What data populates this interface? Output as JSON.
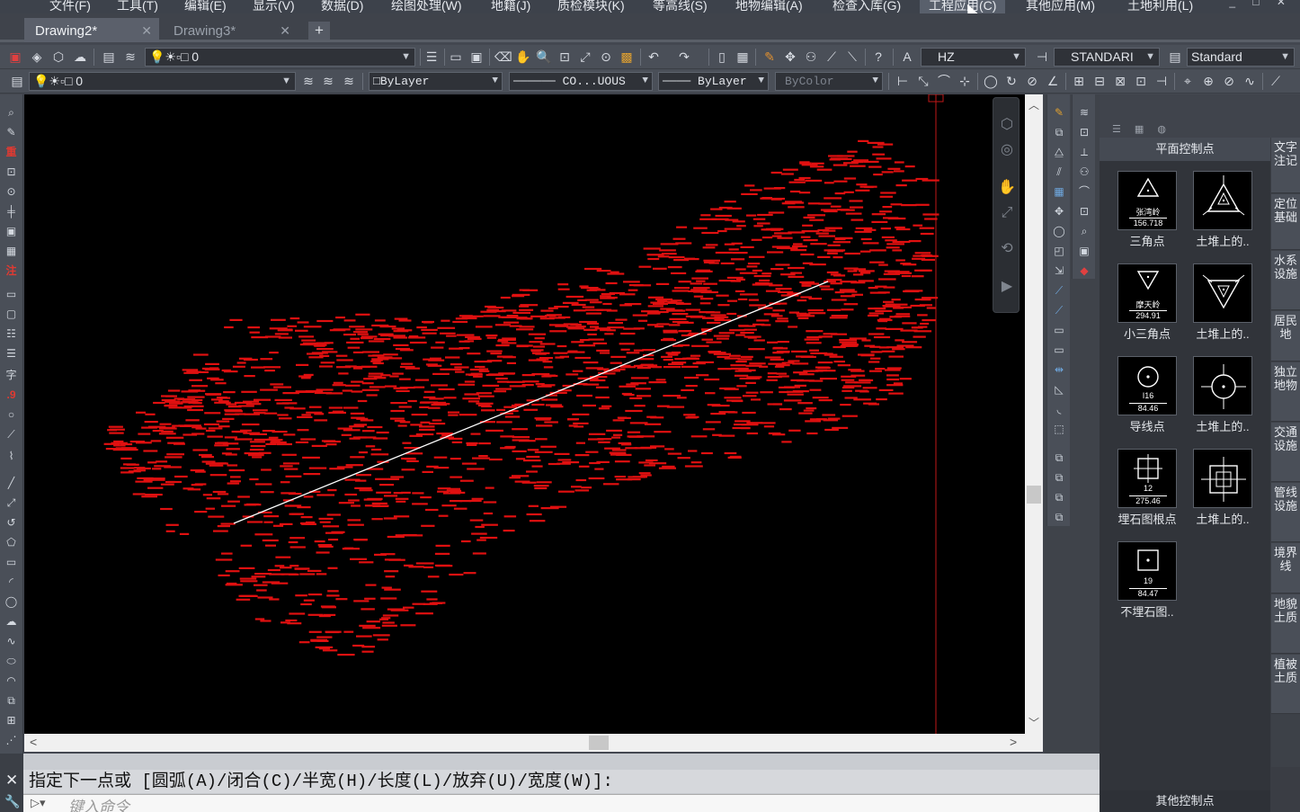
{
  "menu": [
    {
      "label": "文件(F)"
    },
    {
      "label": "工具(T)"
    },
    {
      "label": "编辑(E)"
    },
    {
      "label": "显示(V)"
    },
    {
      "label": "数据(D)"
    },
    {
      "label": "绘图处理(W)"
    },
    {
      "label": "地籍(J)"
    },
    {
      "label": "质检模块(K)"
    },
    {
      "label": "等高线(S)"
    },
    {
      "label": "地物编辑(A)"
    },
    {
      "label": "检查入库(G)"
    },
    {
      "label": "工程应用(C)"
    },
    {
      "label": "其他应用(M)"
    },
    {
      "label": "土地利用(L)"
    }
  ],
  "tabs": [
    {
      "label": "Drawing2*",
      "close": "✕"
    },
    {
      "label": "Drawing3*",
      "close": "✕"
    }
  ],
  "tab_add": "+",
  "toolbar1": {
    "layer_value": "0",
    "textstyle_value": "HZ",
    "dimstyle_value": "STANDARI",
    "tablestyle_value": "Standard"
  },
  "toolbar2": {
    "layer_value": "0",
    "color_value": "ByLayer",
    "linetype_value": "CO...UOUS",
    "lineweight_value": "ByLayer",
    "plotstyle_value": "ByColor"
  },
  "palette": {
    "title": "平面控制点",
    "footer": "其他控制点",
    "symbols": [
      {
        "label": "三角点",
        "name": "张湾岭",
        "value": "156.718",
        "shape": "triangle"
      },
      {
        "label": "土堆上的..",
        "name": "",
        "value": "",
        "shape": "triangle-mound"
      },
      {
        "label": "小三角点",
        "name": "摩天岭",
        "value": "294.91",
        "shape": "triangle-down"
      },
      {
        "label": "土堆上的..",
        "name": "",
        "value": "",
        "shape": "triangle-down-mound"
      },
      {
        "label": "导线点",
        "name": "I16",
        "value": "84.46",
        "shape": "circle"
      },
      {
        "label": "土堆上的..",
        "name": "",
        "value": "",
        "shape": "circle-mound"
      },
      {
        "label": "埋石图根点",
        "name": "12",
        "value": "275.46",
        "shape": "square-cross"
      },
      {
        "label": "土堆上的..",
        "name": "",
        "value": "",
        "shape": "square-cross-mound"
      },
      {
        "label": "不埋石图..",
        "name": "19",
        "value": "84.47",
        "shape": "square-dot"
      }
    ],
    "side_tabs": [
      {
        "label": "文字注记"
      },
      {
        "label": "定位基础"
      },
      {
        "label": "水系设施"
      },
      {
        "label": "居民地"
      },
      {
        "label": "独立地物"
      },
      {
        "label": "交通设施"
      },
      {
        "label": "管线设施"
      },
      {
        "label": "境界线"
      },
      {
        "label": "地貌土质"
      },
      {
        "label": "植被土质"
      }
    ]
  },
  "command": {
    "history": "指定下一点或 [圆弧(A)/闭合(C)/半宽(H)/长度(L)/放弃(U)/宽度(W)]:",
    "placeholder": "键入命令"
  },
  "icons": {
    "close": "close-icon",
    "wrench": "wrench-icon",
    "cursor": "mouse-cursor-icon"
  },
  "colors": {
    "canvas_bg": "#000000",
    "points": "#e01010",
    "polyline": "#ffffff",
    "crosshair": "#c01818"
  }
}
